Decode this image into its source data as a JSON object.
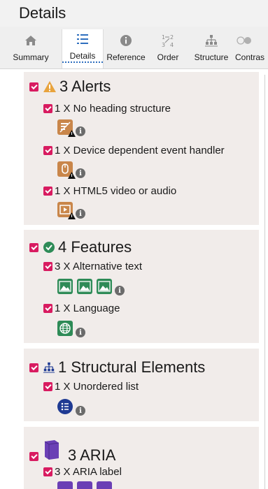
{
  "header": {
    "title": "Details"
  },
  "tabs": [
    {
      "label": "Summary",
      "icon": "home-icon"
    },
    {
      "label": "Details",
      "icon": "list-icon",
      "active": true
    },
    {
      "label": "Reference",
      "icon": "info-icon"
    },
    {
      "label": "Order",
      "icon": "tab-order-icon"
    },
    {
      "label": "Structure",
      "icon": "structure-icon"
    },
    {
      "label": "Contras",
      "icon": "contrast-icon"
    }
  ],
  "sections": {
    "alerts": {
      "title": "3 Alerts",
      "items": [
        {
          "label": "1 X No heading structure"
        },
        {
          "label": "1 X Device dependent event handler"
        },
        {
          "label": "1 X HTML5 video or audio"
        }
      ]
    },
    "features": {
      "title": "4 Features",
      "items": [
        {
          "label": "3 X Alternative text"
        },
        {
          "label": "1 X Language"
        }
      ]
    },
    "structural": {
      "title": "1 Structural Elements",
      "items": [
        {
          "label": "1 X Unordered list"
        }
      ]
    },
    "aria": {
      "title": "3 ARIA",
      "items": [
        {
          "label": "3 X ARIA label"
        }
      ]
    }
  },
  "colors": {
    "checkbox": "#d81b60",
    "alert": "#e8a33d",
    "feature": "#2e8b57",
    "structure": "#1f3a93",
    "aria": "#6a3fb5",
    "section_bg": "#f1ecea"
  }
}
